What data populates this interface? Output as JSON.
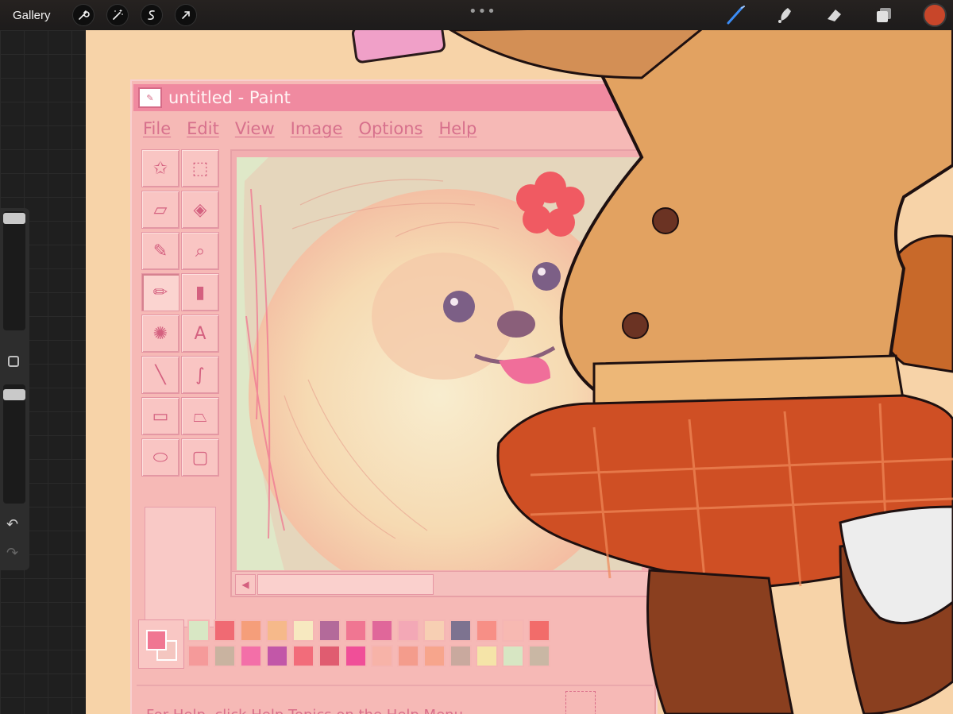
{
  "procreate": {
    "gallery_label": "Gallery",
    "left_tools": [
      "wrench-icon",
      "magic-wand-icon",
      "selection-icon",
      "transform-icon"
    ],
    "right_tools": [
      "brush-icon",
      "smudge-icon",
      "eraser-icon",
      "layers-icon"
    ],
    "current_color": "#c8462a",
    "more_label": "•••"
  },
  "paint": {
    "title": "untitled - Paint",
    "menu": [
      "File",
      "Edit",
      "View",
      "Image",
      "Options",
      "Help"
    ],
    "tools": [
      {
        "name": "free-select-icon",
        "glyph": "✩"
      },
      {
        "name": "rect-select-icon",
        "glyph": "⬚"
      },
      {
        "name": "eraser-tool-icon",
        "glyph": "▱"
      },
      {
        "name": "fill-bucket-icon",
        "glyph": "◈"
      },
      {
        "name": "color-picker-icon",
        "glyph": "✎"
      },
      {
        "name": "magnifier-icon",
        "glyph": "⌕"
      },
      {
        "name": "pencil-icon",
        "glyph": "✏"
      },
      {
        "name": "brush-tool-icon",
        "glyph": "▮"
      },
      {
        "name": "airbrush-icon",
        "glyph": "✺"
      },
      {
        "name": "text-tool-icon",
        "glyph": "A"
      },
      {
        "name": "line-tool-icon",
        "glyph": "╲"
      },
      {
        "name": "curve-tool-icon",
        "glyph": "∫"
      },
      {
        "name": "rectangle-tool-icon",
        "glyph": "▭"
      },
      {
        "name": "polygon-tool-icon",
        "glyph": "⏢"
      },
      {
        "name": "ellipse-tool-icon",
        "glyph": "⬭"
      },
      {
        "name": "rounded-rect-tool-icon",
        "glyph": "▢"
      }
    ],
    "palette_row1": [
      "#d8e7c4",
      "#f06a73",
      "#f59e7a",
      "#f6b98a",
      "#f7e9c0",
      "#b36a9a",
      "#f07692",
      "#e0679a",
      "#f3a8b6",
      "#f7cfb3",
      "#7d7390",
      "#f78f86",
      "#f7b9b2",
      "#f26c6a"
    ],
    "palette_row2": [
      "#f59a9a",
      "#c9b3a0",
      "#f36fa8",
      "#c257a8",
      "#f26c7a",
      "#e05c70",
      "#f04f98",
      "#f7b3a8",
      "#f49c8c",
      "#f7a58c",
      "#c9a99e",
      "#f5e4a8",
      "#d7e6c3",
      "#c9b7a4"
    ],
    "status_text": "For Help, click Help Topics on the Help Menu."
  }
}
